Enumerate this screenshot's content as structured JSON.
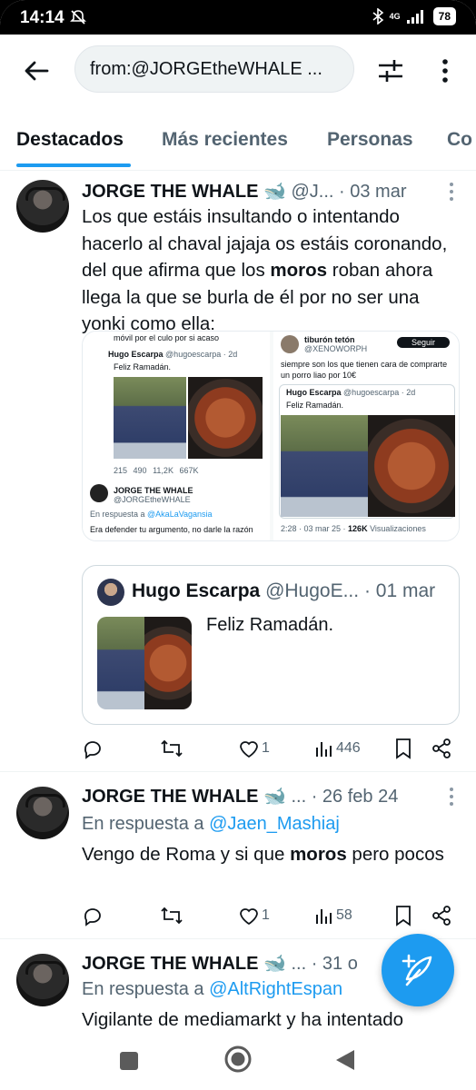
{
  "status_bar": {
    "time": "14:14",
    "network": "4G",
    "battery": "78"
  },
  "header": {
    "search_value": "from:@JORGEtheWHALE ..."
  },
  "tabs": [
    {
      "label": "Destacados",
      "active": true
    },
    {
      "label": "Más recientes",
      "active": false
    },
    {
      "label": "Personas",
      "active": false
    },
    {
      "label": "Co",
      "active": false
    }
  ],
  "tweets": [
    {
      "name": "JORGE THE WHALE",
      "badge_icon": "whale-emoji",
      "handle": "@J...",
      "date": "· 03 mar",
      "text_before": "Los que estáis insultando o intentando hacerlo al chaval jajaja os estáis coronando, del que afirma que los ",
      "text_bold": "moros",
      "text_after": " roban ahora llega la que se burla de él por no ser una yonki como ella:",
      "media": {
        "left_shot": {
          "top_text": "móvil por el culo por si acaso",
          "inner_name": "Hugo Escarpa",
          "inner_handle": "@hugoescarpa · 2d",
          "inner_text": "Feliz Ramadán.",
          "stats": [
            "215",
            "490",
            "11,2K",
            "667K"
          ],
          "reply_name": "JORGE THE WHALE",
          "reply_handle": "@JORGEtheWHALE",
          "reply_to_prefix": "En respuesta a ",
          "reply_to_handle": "@AkaLaVagansia",
          "reply_text": "Era defender tu argumento, no darle la razón"
        },
        "right_shot": {
          "user_name": "tiburón tetón",
          "user_handle": "@XENOWORPH",
          "follow_label": "Seguir",
          "text": "siempre son los que tienen cara de comprarte un porro liao por 10€",
          "inner_name": "Hugo Escarpa",
          "inner_handle": "@hugoescarpa · 2d",
          "inner_text": "Feliz Ramadán.",
          "footer_time": "2:28 · 03 mar 25 · ",
          "footer_views": "126K",
          "footer_views_label": " Visualizaciones"
        }
      },
      "quote": {
        "name": "Hugo Escarpa",
        "handle": "@HugoE...",
        "date": "· 01 mar",
        "text": "Feliz Ramadán."
      },
      "actions": {
        "reply": "",
        "retweet": "",
        "likes": "1",
        "views": "446"
      }
    },
    {
      "name": "JORGE THE WHALE",
      "badge_icon": "whale-emoji",
      "handle": "...",
      "date": "· 26 feb 24",
      "reply_to_prefix": "En respuesta a ",
      "reply_to_handle": "@Jaen_Mashiaj",
      "text_before": "Vengo de Roma y si que ",
      "text_bold": "moros",
      "text_after": " pero pocos",
      "actions": {
        "reply": "",
        "retweet": "",
        "likes": "1",
        "views": "58"
      }
    },
    {
      "name": "JORGE THE WHALE",
      "badge_icon": "whale-emoji",
      "handle": "...",
      "date": "· 31 o",
      "reply_to_prefix": "En respuesta a ",
      "reply_to_handle": "@AltRightEspan",
      "text": "Vigilante de mediamarkt y ha intentado"
    }
  ],
  "colors": {
    "accent": "#1d9bf0",
    "text": "#0f1419",
    "secondary": "#536471"
  }
}
